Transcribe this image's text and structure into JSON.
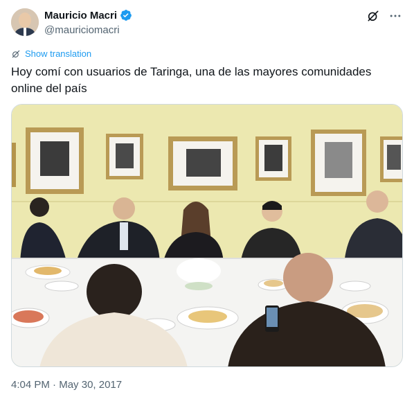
{
  "author": {
    "name": "Mauricio Macri",
    "handle": "@mauriciomacri",
    "verified": true
  },
  "actions": {
    "grok_icon": "grok-icon",
    "more_icon": "more-icon"
  },
  "translation": {
    "label": "Show translation"
  },
  "tweet": {
    "text": "Hoy comí con usuarios de Taringa, una de las mayores comunidades online del país"
  },
  "timestamp": {
    "time": "4:04 PM",
    "separator": "·",
    "date": "May 30, 2017"
  },
  "colors": {
    "accent": "#1d9bf0",
    "secondary_text": "#536471",
    "wall": "#ece8b0",
    "tablecloth": "#f4f4f2"
  }
}
